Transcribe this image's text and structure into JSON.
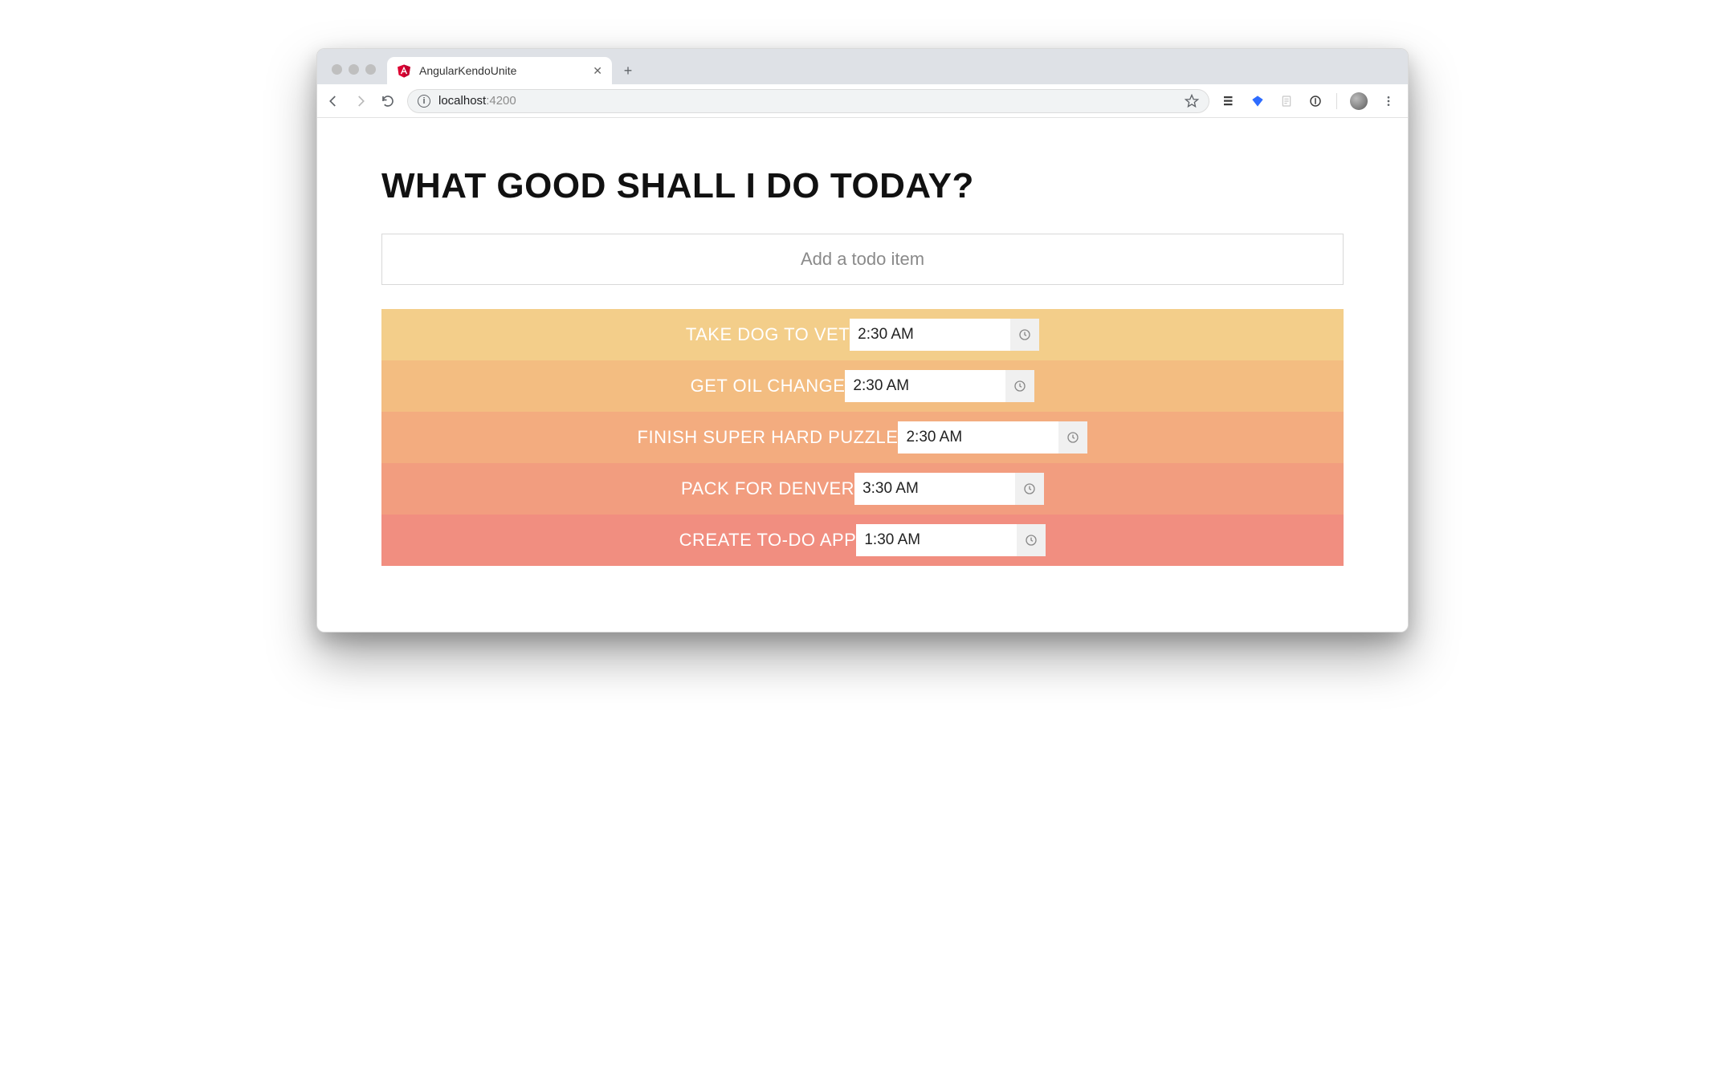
{
  "browser": {
    "tab_title": "AngularKendoUnite",
    "url_host": "localhost",
    "url_port": ":4200"
  },
  "page": {
    "heading": "WHAT GOOD SHALL I DO TODAY?",
    "add_placeholder": "Add a todo item"
  },
  "todos": [
    {
      "label": "TAKE DOG TO VET",
      "time": "2:30 AM"
    },
    {
      "label": "GET OIL CHANGE",
      "time": "2:30 AM"
    },
    {
      "label": "FINISH SUPER HARD PUZZLE",
      "time": "2:30 AM"
    },
    {
      "label": "PACK FOR DENVER",
      "time": "3:30 AM"
    },
    {
      "label": "CREATE TO-DO APP",
      "time": "1:30 AM"
    }
  ]
}
